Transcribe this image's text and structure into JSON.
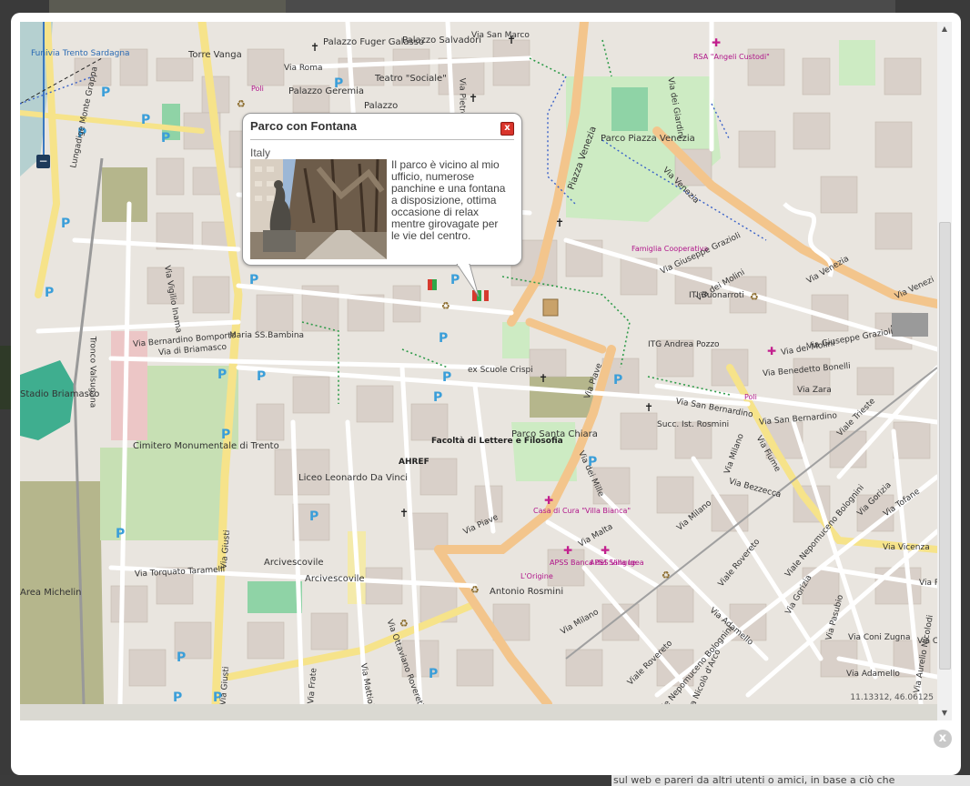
{
  "popup": {
    "title": "Parco con Fontana",
    "close_label": "x",
    "country": "Italy",
    "description": "Il parco è vicino al mio ufficio, numerose panchine e una fontana a disposizione, ottima occasione di relax mentre girovagate per le vie del centro."
  },
  "map": {
    "coordinates": "11.13312, 46.06125",
    "zoom_out_label": "−"
  },
  "modal": {
    "close_label": "x"
  },
  "background": {
    "footer_text": "sul web e pareri da altri utenti o amici, in base a ciò che"
  },
  "labels": {
    "funivia": "Funivia Trento Sardagna",
    "torre_vanga": "Torre Vanga",
    "palazzo_fuger": "Palazzo Fuger Galasso",
    "palazzo_salvadori": "Palazzo Salvadori",
    "via_san_marco": "Via San Marco",
    "via_roma": "Via Roma",
    "poli_1": "Poli",
    "palazzo_geremia": "Palazzo Geremia",
    "teatro_sociale": "Teatro \"Sociale\"",
    "palazzo_trunc": "Palazzo",
    "rsa": "RSA \"Angeli Custodi\"",
    "parco_piazza_venezia": "Parco Piazza Venezia",
    "piazza_venezia": "Piazza Venezia",
    "via_venezia_1": "Via Venezia",
    "via_venezia_2": "Via Venezia",
    "via_venezia_3": "Via Venezi",
    "famiglia_cooperativa": "Famiglia Cooperativa",
    "via_giuseppe_grazioli_1": "Via Giuseppe Grazioli",
    "via_giuseppe_grazioli_2": "Via Giuseppe Grazioli",
    "via_dei_molini_1": "Via dei Molini",
    "via_dei_molini_2": "Via dei Molini",
    "iti_buonarroti": "ITI Buonarroti",
    "itg_pozzo": "ITG Andrea Pozzo",
    "via_dei_giardini": "Via dei Giardini",
    "lungadige": "Lungadige Monte Grappa",
    "via_vigilio_inama": "Via Vigilio Inama",
    "via_bernardino_bomporto": "Via Bernardino Bomporto",
    "via_di_briamasco": "Via di Briamasco",
    "maria_ss_bambina": "Maria SS.Bambina",
    "tronco_valsugana": "Tronco Valsugana",
    "stadio": "Stadio Briamasco",
    "ex_scuole_crispi": "ex Scuole Crispi",
    "via_piave_1": "Via Piave",
    "via_piave_2": "Via Piave",
    "via_san_bernardino_1": "Via San Bernardino",
    "via_san_bernardino_2": "Via San Bernardino",
    "via_benedetto_bonelli": "Via Benedetto Bonelli",
    "via_zara": "Via Zara",
    "poli_2": "Poli",
    "succ_rosmini": "Succ. Ist. Rosmini",
    "viale_trieste": "Viale Trieste",
    "via_fiume": "Via Fiume",
    "via_milano_1": "Via Milano",
    "via_milano_2": "Via Milano",
    "via_milano_3": "Via Milano",
    "via_bezzecca": "Via Bezzecca",
    "facolta": "Facoltà di Lettere e Filosofia",
    "ahref": "AHREF",
    "parco_santa_chiara": "Parco Santa Chiara",
    "cimitero": "Cimitero Monumentale di Trento",
    "liceo_da_vinci": "Liceo Leonardo Da Vinci",
    "via_dei_mille": "Via dei Mille",
    "casa_di_cura": "Casa di Cura \"Villa Bianca\"",
    "via_malta": "Via Malta",
    "apss_banca": "APSS Banca del Sangue",
    "apss_igea": "APSS Villa Igea",
    "l_ortigine": "L'Origine",
    "antonio_rosmini": "Antonio Rosmini",
    "arcivescovile_1": "Arcivescovile",
    "arcivescovile_2": "Arcivescovile",
    "via_torquato_taramelli": "Via Torquato Taramelli",
    "area_michelin": "Area Michelin",
    "via_giusti_1": "Via Giusti",
    "via_giusti_2": "Via Giusti",
    "via_fratelli": "Via Frate",
    "via_ottaviano": "Via Ottaviano Rovereti",
    "via_mattioli": "Via Mattioli",
    "viale_rovereto_1": "Viale Rovereto",
    "viale_rovereto_2": "Viale Rovereto",
    "viale_nepomuceno_1": "Viale Nepomuceno Bolognini",
    "viale_nepomuceno_2": "Viale Nepomuceno Bolognini",
    "via_adamello_1": "Via Adamello",
    "via_adamello_2": "Via Adamello",
    "via_nicolo_darco": "Via Nicolò d'Arco",
    "via_gorizia_1": "Via Gorizia",
    "via_gorizia_2": "Via Gorizia",
    "via_tofane": "Via Tofane",
    "via_vicenza": "Via Vicenza",
    "via_pade": "Via Pade",
    "via_pasubio": "Via Pasubio",
    "via_coni_zugna": "Via Coni Zugna",
    "via_aurelio_nicolodi": "Via Aurelio Nicolodi",
    "via_c": "Via C",
    "via_pietro": "Via Pietro"
  },
  "parking_label": "P"
}
